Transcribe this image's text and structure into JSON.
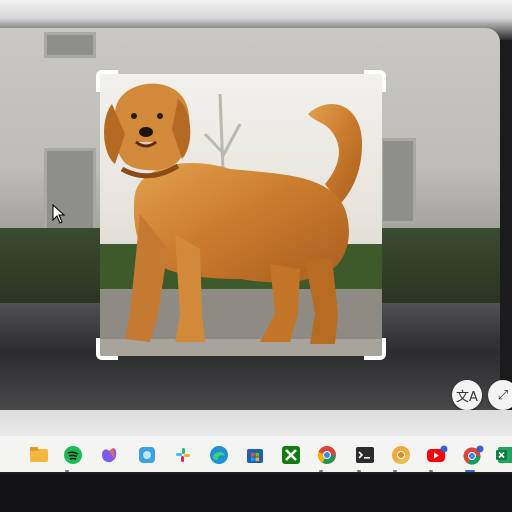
{
  "viewer": {
    "translate_button_icon": "translate-icon",
    "expand_button_icon": "expand-icon"
  },
  "taskbar": {
    "apps": [
      {
        "name": "file-explorer-icon"
      },
      {
        "name": "spotify-icon"
      },
      {
        "name": "copilot-icon"
      },
      {
        "name": "photos-icon"
      },
      {
        "name": "slack-icon"
      },
      {
        "name": "edge-icon"
      },
      {
        "name": "microsoft-store-icon"
      },
      {
        "name": "xbox-icon"
      },
      {
        "name": "chrome-icon"
      },
      {
        "name": "terminal-icon"
      },
      {
        "name": "chrome-canary-icon"
      },
      {
        "name": "youtube-icon"
      },
      {
        "name": "chrome-profile-icon"
      },
      {
        "name": "excel-icon"
      }
    ]
  }
}
